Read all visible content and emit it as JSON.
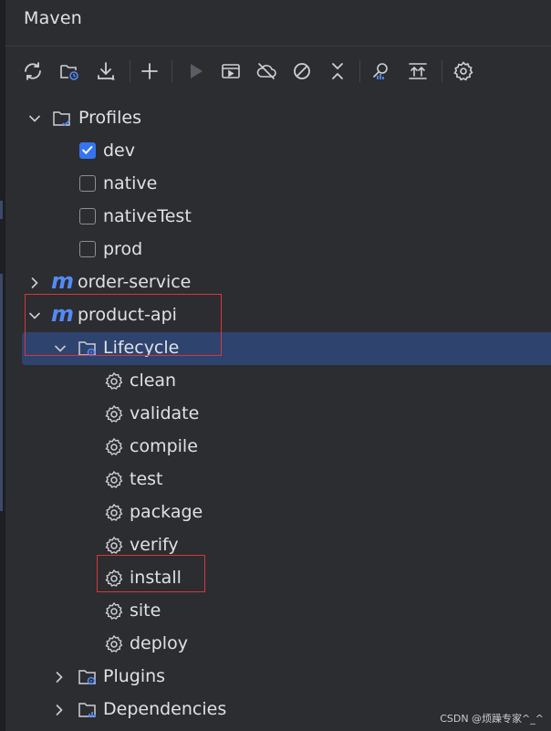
{
  "panel": {
    "title": "Maven"
  },
  "toolbar": {
    "buttons": [
      {
        "icon": "reload-icon"
      },
      {
        "icon": "generate-sources-icon"
      },
      {
        "icon": "download-icon"
      },
      {
        "icon": "add-icon"
      },
      {
        "icon": "run-icon"
      },
      {
        "icon": "execute-goal-icon"
      },
      {
        "icon": "offline-mode-icon"
      },
      {
        "icon": "skip-tests-icon"
      },
      {
        "icon": "collapse-icon"
      },
      {
        "icon": "analyze-dependencies-icon"
      },
      {
        "icon": "expand-all-icon"
      },
      {
        "icon": "settings-icon"
      }
    ]
  },
  "tree": {
    "profiles": {
      "label": "Profiles",
      "items": [
        {
          "label": "dev",
          "checked": true
        },
        {
          "label": "native",
          "checked": false
        },
        {
          "label": "nativeTest",
          "checked": false
        },
        {
          "label": "prod",
          "checked": false
        }
      ]
    },
    "modules": [
      {
        "label": "order-service",
        "expanded": false
      },
      {
        "label": "product-api",
        "expanded": true
      }
    ],
    "lifecycle": {
      "label": "Lifecycle",
      "goals": [
        "clean",
        "validate",
        "compile",
        "test",
        "package",
        "verify",
        "install",
        "site",
        "deploy"
      ]
    },
    "plugins": {
      "label": "Plugins"
    },
    "dependencies": {
      "label": "Dependencies"
    }
  },
  "watermark": "CSDN @烦躁专家^_^",
  "colors": {
    "background": "#2b2d30",
    "selection": "#2e436e",
    "accent": "#548af7",
    "highlight": "#d8373a"
  }
}
